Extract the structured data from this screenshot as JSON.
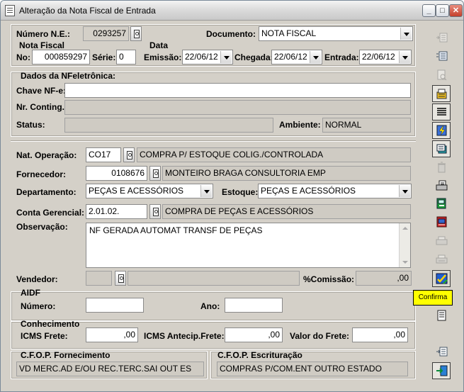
{
  "window": {
    "title": "Alteração da Nota Fiscal de Entrada",
    "buttons": {
      "minimize": "_",
      "maximize": "□",
      "close": "✕"
    }
  },
  "header": {
    "numero_ne_label": "Número N.E.:",
    "numero_ne_value": "0293257",
    "documento_label": "Documento:",
    "documento_value": "NOTA FISCAL",
    "nota_fiscal_label": "Nota Fiscal",
    "data_label": "Data",
    "no_label": "No:",
    "no_value": "000859297",
    "serie_label": "Série:",
    "serie_value": "0",
    "emissao_label": "Emissão:",
    "emissao_value": "22/06/12",
    "chegada_label": "Chegada:",
    "chegada_value": "22/06/12",
    "entrada_label": "Entrada:",
    "entrada_value": "22/06/12"
  },
  "nfe": {
    "section_label": "Dados da NFeletrônica:",
    "chave_label": "Chave NF-e:",
    "chave_value": "",
    "contingencia_label": "Nr. Conting.:",
    "contingencia_value": "",
    "status_label": "Status:",
    "status_value": "",
    "ambiente_label": "Ambiente:",
    "ambiente_value": "NORMAL"
  },
  "main": {
    "nat_operacao_label": "Nat. Operação:",
    "nat_operacao_code": "CO17",
    "nat_operacao_desc": "COMPRA P/ ESTOQUE COLIG./CONTROLADA",
    "fornecedor_label": "Fornecedor:",
    "fornecedor_code": "0108676",
    "fornecedor_desc": "MONTEIRO BRAGA CONSULTORIA EMP",
    "departamento_label": "Departamento:",
    "departamento_value": "PEÇAS E ACESSÓRIOS",
    "estoque_label": "Estoque:",
    "estoque_value": "PEÇAS E ACESSÓRIOS",
    "conta_label": "Conta Gerencial:",
    "conta_code": "2.01.02.",
    "conta_desc": "COMPRA DE PEÇAS E ACESSÓRIOS",
    "observacao_label": "Observação:",
    "observacao_value": "NF GERADA AUTOMAT TRANSF DE PEÇAS",
    "vendedor_label": "Vendedor:",
    "vendedor_code": "",
    "vendedor_desc": "",
    "comissao_label": "%Comissão:",
    "comissao_value": ",00"
  },
  "aidf": {
    "section_label": "AIDF",
    "numero_label": "Número:",
    "numero_value": "",
    "ano_label": "Ano:",
    "ano_value": ""
  },
  "conhecimento": {
    "section_label": "Conhecimento",
    "icms_frete_label": "ICMS Frete:",
    "icms_frete_value": ",00",
    "icms_antecip_label": "ICMS Antecip.Frete:",
    "icms_antecip_value": ",00",
    "valor_frete_label": "Valor do Frete:",
    "valor_frete_value": ",00"
  },
  "cfop": {
    "fornecimento_label": "C.F.O.P. Fornecimento",
    "fornecimento_value": "VD MERC.AD E/OU REC.TERC.SAI OUT ES",
    "escrituracao_label": "C.F.O.P. Escrituração",
    "escrituracao_value": "COMPRAS P/COM.ENT OUTRO ESTADO"
  },
  "toolbar": {
    "items": [
      "itens-icon",
      "duplicatas-icon",
      "visualizar-icon",
      "impostos-icon",
      "lista-icon",
      "processar-icon",
      "notas-icon",
      "excluir-icon",
      "imprimir-doc-icon",
      "transferir-icon",
      "financeiro-icon",
      "print-icon",
      "print2-icon",
      "confirma-icon",
      "consulta-icon",
      "exportar-icon",
      "sair-icon"
    ],
    "tooltip": "Confirma"
  }
}
